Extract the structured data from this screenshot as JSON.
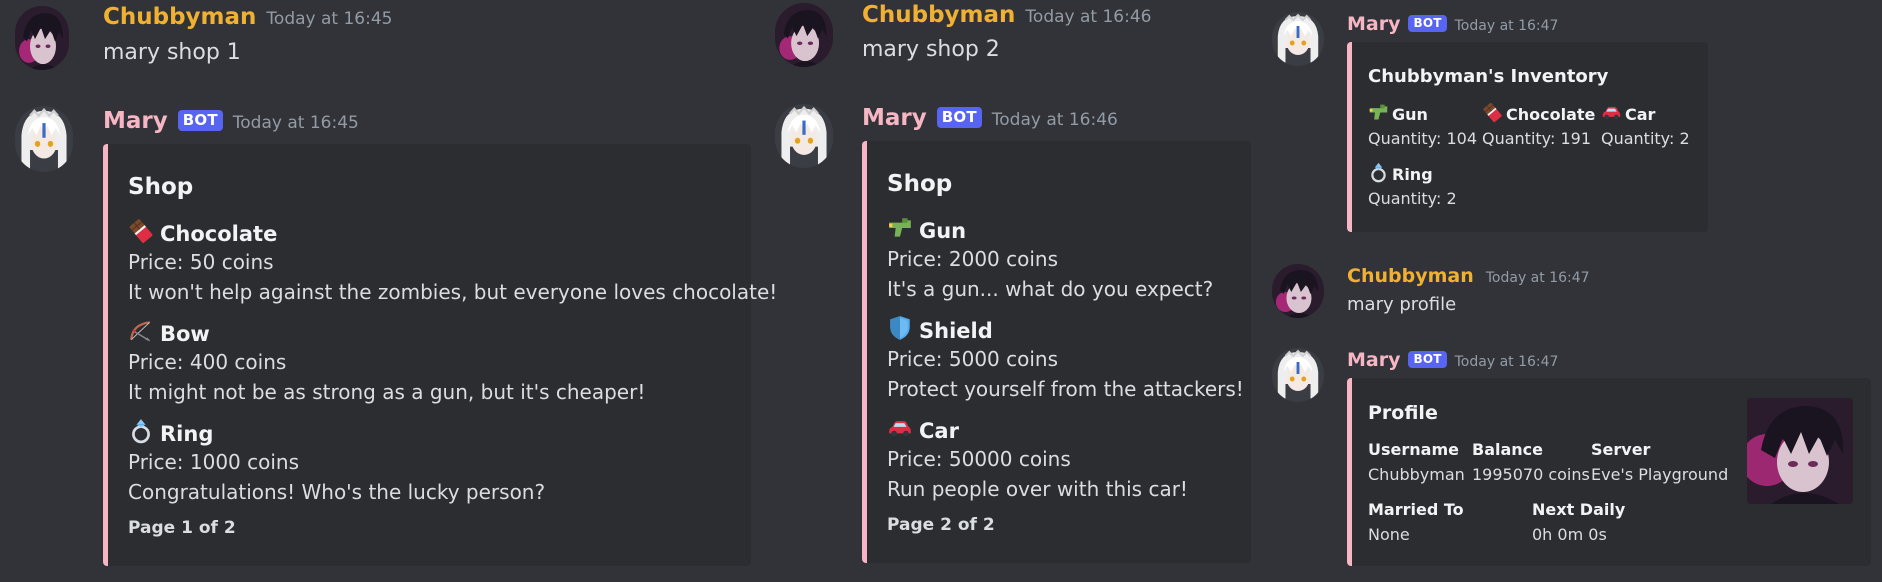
{
  "colors": {
    "background": "#313338",
    "embed_bg": "#2b2d31",
    "embed_border": "#f6b6c3",
    "human_name": "#f0b132",
    "bot_name": "#f6b6c3",
    "bot_badge": "#5865f2"
  },
  "col1": {
    "user_msg": {
      "username": "Chubbyman",
      "timestamp": "Today at 16:45",
      "text": "mary shop 1"
    },
    "bot_msg": {
      "username": "Mary",
      "badge": "BOT",
      "timestamp": "Today at 16:45",
      "embed": {
        "title": "Shop",
        "fields": [
          {
            "icon": "chocolate-icon",
            "name": "Chocolate",
            "price": "Price: 50 coins",
            "desc": "It won't help against the zombies, but everyone loves chocolate!"
          },
          {
            "icon": "bow-icon",
            "name": "Bow",
            "price": "Price: 400 coins",
            "desc": "It might not be as strong as a gun, but it's cheaper!"
          },
          {
            "icon": "ring-icon",
            "name": "Ring",
            "price": "Price: 1000 coins",
            "desc": "Congratulations! Who's the lucky person?"
          }
        ],
        "footer": "Page 1 of 2"
      }
    }
  },
  "col2": {
    "user_msg": {
      "username": "Chubbyman",
      "timestamp": "Today at 16:46",
      "text": "mary shop 2"
    },
    "bot_msg": {
      "username": "Mary",
      "badge": "BOT",
      "timestamp": "Today at 16:46",
      "embed": {
        "title": "Shop",
        "fields": [
          {
            "icon": "water-gun-icon",
            "name": "Gun",
            "price": "Price: 2000 coins",
            "desc": "It's a gun... what do you expect?"
          },
          {
            "icon": "shield-icon",
            "name": "Shield",
            "price": "Price: 5000 coins",
            "desc": "Protect yourself from the attackers!"
          },
          {
            "icon": "car-icon",
            "name": "Car",
            "price": "Price: 50000 coins",
            "desc": "Run people over with this car!"
          }
        ],
        "footer": "Page 2 of 2"
      }
    }
  },
  "col3": {
    "inventory_msg": {
      "username": "Mary",
      "badge": "BOT",
      "timestamp": "Today at 16:47",
      "embed": {
        "title": "Chubbyman's Inventory",
        "items": [
          {
            "icon": "water-gun-icon",
            "name": "Gun",
            "qty": "Quantity: 104"
          },
          {
            "icon": "chocolate-icon",
            "name": "Chocolate",
            "qty": "Quantity: 191"
          },
          {
            "icon": "car-icon",
            "name": "Car",
            "qty": "Quantity: 2"
          },
          {
            "icon": "ring-icon",
            "name": "Ring",
            "qty": "Quantity: 2"
          }
        ]
      }
    },
    "user_msg": {
      "username": "Chubbyman",
      "timestamp": "Today at 16:47",
      "text": "mary profile"
    },
    "profile_msg": {
      "username": "Mary",
      "badge": "BOT",
      "timestamp": "Today at 16:47",
      "embed": {
        "title": "Profile",
        "fields": [
          {
            "name": "Username",
            "value": "Chubbyman"
          },
          {
            "name": "Balance",
            "value": "1995070 coins"
          },
          {
            "name": "Server",
            "value": "Eve's Playground"
          },
          {
            "name": "Married To",
            "value": "None"
          },
          {
            "name": "Next Daily",
            "value": "0h 0m 0s"
          }
        ]
      }
    }
  }
}
